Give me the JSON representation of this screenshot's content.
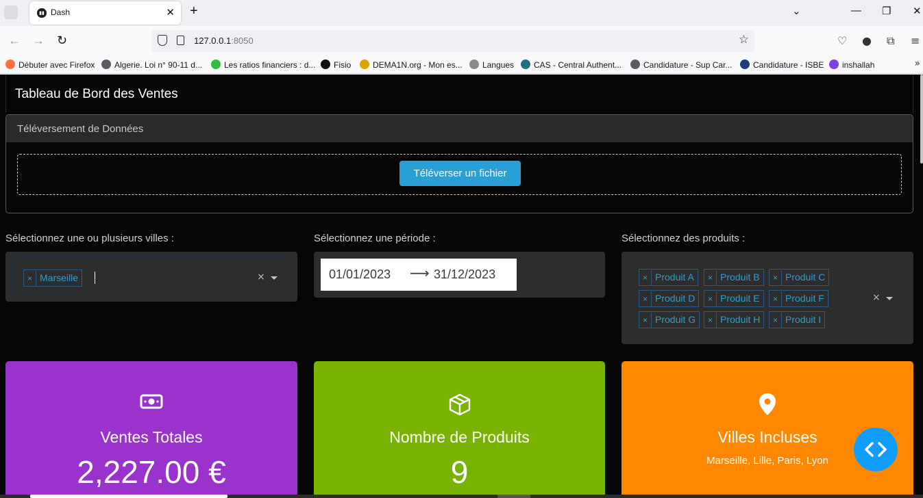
{
  "browser": {
    "tab_title": "Dash",
    "tab_close": "✕",
    "new_tab": "+",
    "url_host": "127.0.0.1",
    "url_port": ":8050",
    "bookmarks": [
      {
        "label": "Débuter avec Firefox",
        "color": "#ff7139"
      },
      {
        "label": "Algerie. Loi n° 90-11 d...",
        "color": "#5b5b66"
      },
      {
        "label": "Les ratios financiers : d...",
        "color": "#2fbf3a"
      },
      {
        "label": "Fisio",
        "color": "#111111"
      },
      {
        "label": "DEMA1N.org - Mon es...",
        "color": "#d9a400"
      },
      {
        "label": "Langues",
        "color": "#8a8a8a"
      },
      {
        "label": "CAS - Central Authent...",
        "color": "#1f6f84"
      },
      {
        "label": "Candidature - Sup Car...",
        "color": "#5b5b66"
      },
      {
        "label": "Candidature - ISBE",
        "color": "#1c3f7a"
      },
      {
        "label": "inshallah",
        "color": "#7b3fe4"
      }
    ]
  },
  "header": {
    "title": "Tableau de Bord des Ventes"
  },
  "upload": {
    "heading": "Téléversement de Données",
    "button_label": "Téléverser un fichier"
  },
  "filters": {
    "cities": {
      "label": "Sélectionnez une ou plusieurs villes :",
      "selected": [
        "Marseille"
      ]
    },
    "period": {
      "label": "Sélectionnez une période :",
      "start": "01/01/2023",
      "end": "31/12/2023"
    },
    "products": {
      "label": "Sélectionnez des produits :",
      "selected": [
        "Produit A",
        "Produit B",
        "Produit C",
        "Produit D",
        "Produit E",
        "Produit F",
        "Produit G",
        "Produit H",
        "Produit I"
      ]
    }
  },
  "kpis": {
    "sales": {
      "title": "Ventes Totales",
      "value": "2,227.00 €",
      "icon": "money-icon",
      "color": "#9933cc"
    },
    "products": {
      "title": "Nombre de Produits",
      "value": "9",
      "icon": "box-icon",
      "color": "#77b300"
    },
    "cities": {
      "title": "Villes Incluses",
      "value": "Marseille, Lille, Paris, Lyon",
      "icon": "map-pin-icon",
      "color": "#ff8800"
    }
  }
}
